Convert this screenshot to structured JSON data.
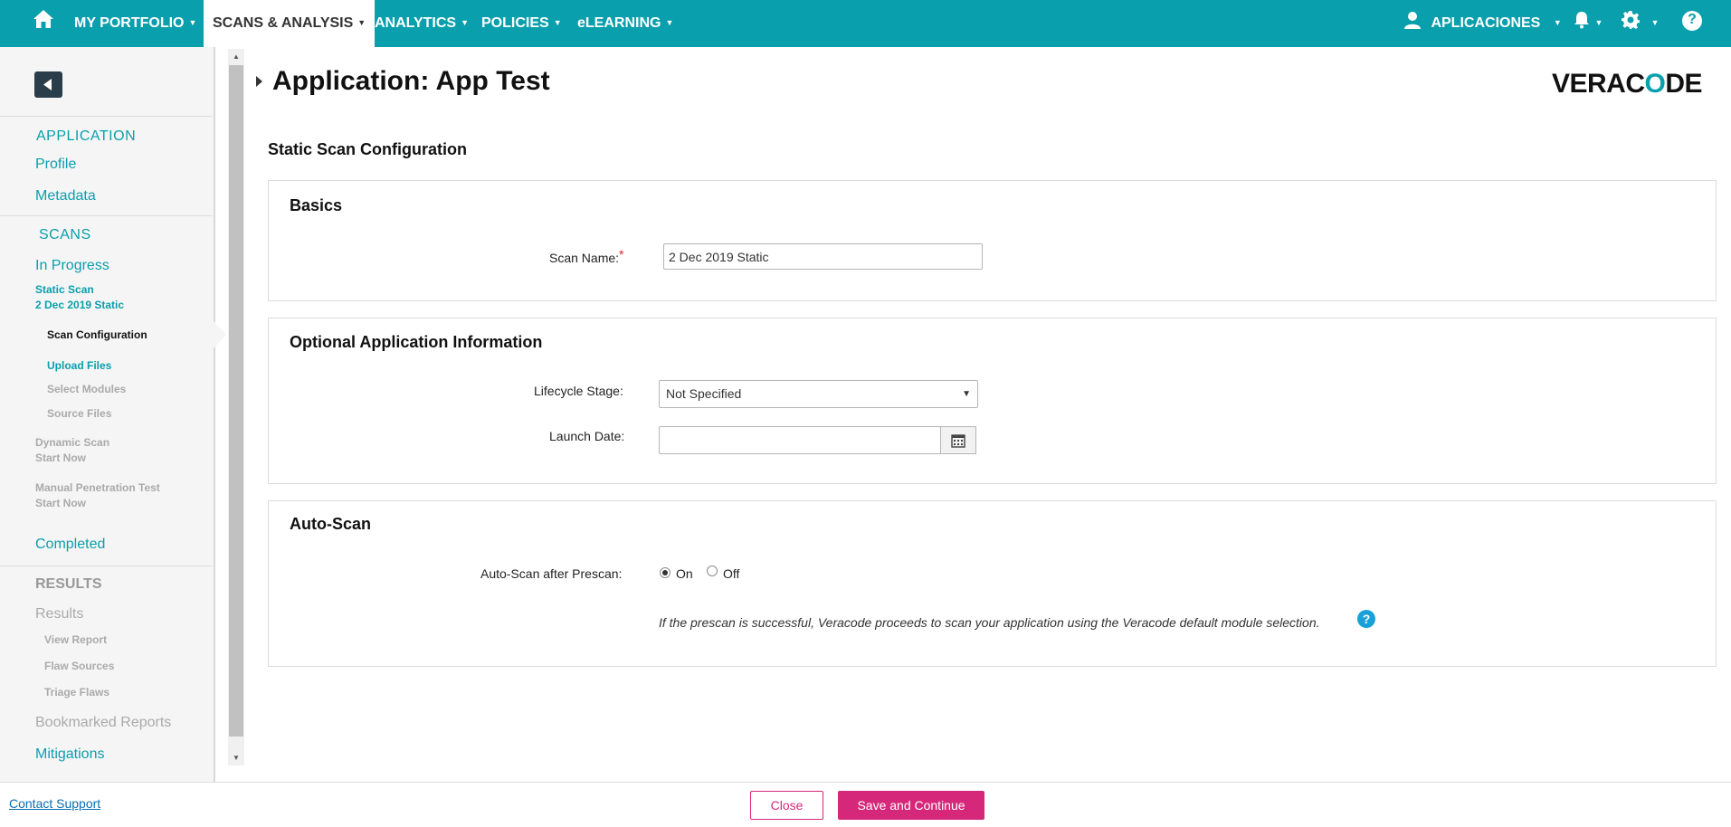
{
  "nav": {
    "items": [
      {
        "label": "MY PORTFOLIO"
      },
      {
        "label": "SCANS & ANALYSIS"
      },
      {
        "label": "ANALYTICS"
      },
      {
        "label": "POLICIES"
      },
      {
        "label": "eLEARNING"
      }
    ],
    "user_label": "APLICACIONES",
    "help_label": "?"
  },
  "sidebar": {
    "application_heading": "APPLICATION",
    "profile": "Profile",
    "metadata": "Metadata",
    "scans_heading": "SCANS",
    "in_progress": "In Progress",
    "static_scan_line1": "Static Scan",
    "static_scan_line2": "2 Dec 2019 Static",
    "scan_configuration": "Scan Configuration",
    "upload_files": "Upload Files",
    "select_modules": "Select Modules",
    "source_files": "Source Files",
    "dynamic_scan_line1": "Dynamic Scan",
    "dynamic_scan_line2": "Start Now",
    "manual_pen_line1": "Manual Penetration Test",
    "manual_pen_line2": "Start Now",
    "completed": "Completed",
    "results_heading": "RESULTS",
    "results": "Results",
    "view_report": "View Report",
    "flaw_sources": "Flaw Sources",
    "triage_flaws": "Triage Flaws",
    "bookmarked_reports": "Bookmarked Reports",
    "mitigations": "Mitigations"
  },
  "main": {
    "app_title": "Application: App Test",
    "logo_text_a": "VERAC",
    "logo_text_b": "O",
    "logo_text_c": "DE",
    "section_title": "Static Scan Configuration",
    "basics": {
      "title": "Basics",
      "scan_name_label": "Scan Name:",
      "required_mark": "*",
      "scan_name_value": "2 Dec 2019 Static"
    },
    "optional": {
      "title": "Optional Application Information",
      "lifecycle_label": "Lifecycle Stage:",
      "lifecycle_value": "Not Specified",
      "launch_date_label": "Launch Date:",
      "launch_date_value": ""
    },
    "autoscan": {
      "title": "Auto-Scan",
      "label": "Auto-Scan after Prescan:",
      "on_label": "On",
      "off_label": "Off",
      "selected": "On",
      "note": "If the prescan is successful, Veracode proceeds to scan your application using the Veracode default module selection."
    }
  },
  "footer": {
    "contact_support": "Contact Support",
    "close_label": "Close",
    "save_label": "Save and Continue"
  },
  "colors": {
    "nav_bg": "#0a9fac",
    "accent": "#0a9fac",
    "primary_button": "#d6287a",
    "help_icon": "#1aa0d8"
  }
}
